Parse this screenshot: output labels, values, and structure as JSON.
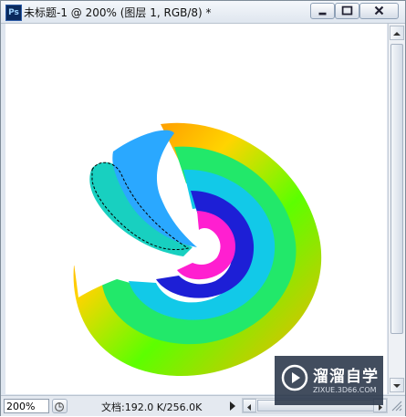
{
  "window": {
    "app_icon": "Ps",
    "title": "未标题-1 @ 200% (图层 1, RGB/8) *"
  },
  "status": {
    "zoom": "200%",
    "doc_info": "文档:192.0 K/256.0K"
  },
  "watermark": {
    "title": "溜溜自学",
    "url": "ZIXUE.3D66.COM"
  },
  "icons": {
    "minimize": "minimize-icon",
    "maximize": "maximize-icon",
    "close": "close-icon",
    "scroll_up": "arrow-up-icon",
    "scroll_down": "arrow-down-icon",
    "scroll_left": "arrow-left-icon",
    "scroll_right": "arrow-right-icon",
    "navigator": "navigator-icon",
    "status_menu": "triangle-right-icon",
    "watermark_logo": "play-logo-icon"
  },
  "colors": {
    "window_chrome": "#dfe6ef",
    "canvas": "#ffffff",
    "watermark_bg": "#283448"
  }
}
